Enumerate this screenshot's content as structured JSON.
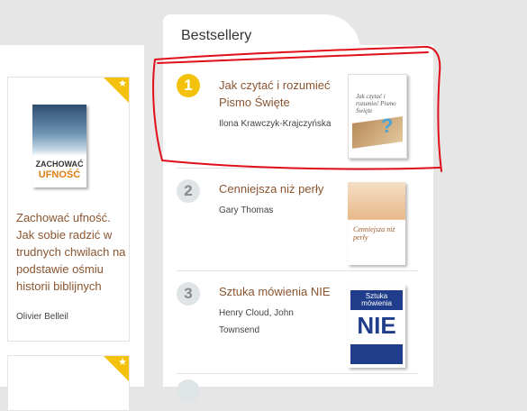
{
  "promo": {
    "cover_line1": "ZACHOWAĆ",
    "cover_line2": "UFNOŚĆ",
    "title": "Zachować ufność. Jak sobie radzić w trudnych chwilach na podstawie ośmiu historii biblijnych",
    "author": "Olivier Belleil"
  },
  "bestsellers": {
    "heading": "Bestsellery",
    "items": [
      {
        "rank": "1",
        "title": "Jak czytać i rozumieć Pismo Święte",
        "author": "Ilona Krawczyk-Krajczyńska",
        "cover_title": "Jak czytać i rozumieć Pismo Święte"
      },
      {
        "rank": "2",
        "title": "Cenniejsza niż perły",
        "author": "Gary Thomas",
        "cover_title": "Cenniejsza niż perły"
      },
      {
        "rank": "3",
        "title": "Sztuka mówienia NIE",
        "author": "Henry Cloud, John Townsend",
        "cover_title": "Sztuka mówienia",
        "cover_word": "NIE"
      }
    ]
  },
  "colors": {
    "title_brown": "#8a5530",
    "rank_gold": "#f4c20d",
    "annotation_red": "#e0101a"
  }
}
